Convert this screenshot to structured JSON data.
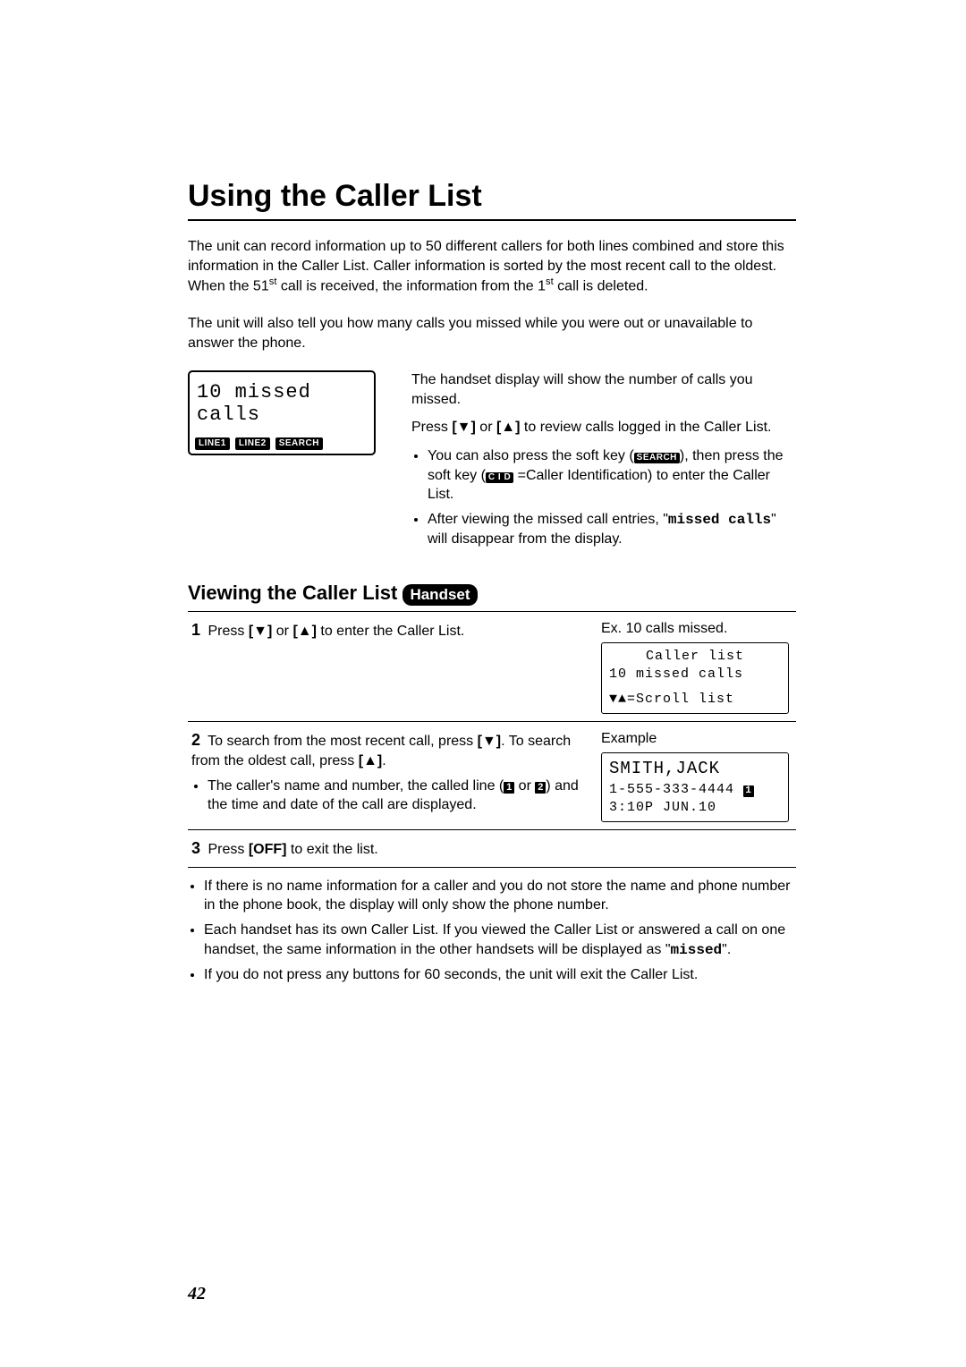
{
  "title": "Using the Caller List",
  "intro1_a": "The unit can record information up to 50 different callers for both lines combined and store this information in the Caller List. Caller information is sorted by the most recent call to the oldest. When the 51",
  "intro1_sup": "st",
  "intro1_b": " call is received, the information from the 1",
  "intro1_sup2": "st",
  "intro1_c": " call is deleted.",
  "intro2": "The unit will also tell you how many calls you missed while you were out or unavailable to answer the phone.",
  "handset_lcd": {
    "line1": "10 missed calls",
    "softkeys": [
      "LINE1",
      "LINE2",
      "SEARCH"
    ]
  },
  "right": {
    "p1": "The handset display will show the number of calls you missed.",
    "p2a": "Press ",
    "down": "[▼]",
    "or": " or ",
    "up": "[▲]",
    "p2b": " to review calls logged in the Caller List.",
    "b1a": "You can also press the soft key (",
    "b1_key1": "SEARCH",
    "b1b": "), then press the soft key (",
    "b1_key2": " C I D ",
    "b1c": " =Caller Identification) to enter the Caller List.",
    "b2a": "After viewing the missed call entries, \"",
    "b2_mono": "missed calls",
    "b2b": "\" will disappear from the display."
  },
  "subheading": "Viewing the Caller List",
  "badge": "Handset",
  "steps": {
    "s1": {
      "num": "1",
      "text_a": "Press ",
      "text_b": " to enter the Caller List.",
      "caption": "Ex. 10 calls missed.",
      "lcd": {
        "l1": "Caller list",
        "l2": "10 missed calls",
        "l3": "▼▲=Scroll list"
      }
    },
    "s2": {
      "num": "2",
      "text_a": "To search from the most recent call, press ",
      "text_bracket_down": "[▼]",
      "text_b": ". To search from the oldest call, press ",
      "text_bracket_up": "[▲]",
      "text_c": ".",
      "sub_a": "The caller's name and number, the called line (",
      "n1": "1",
      "sub_b": " or ",
      "n2": "2",
      "sub_c": ") and the time and date of the call are displayed.",
      "caption": "Example",
      "lcd": {
        "l1": "SMITH,JACK",
        "l2a": "1-555-333-4444 ",
        "l2n": "1",
        "l3": "3:10P JUN.10"
      }
    },
    "s3": {
      "num": "3",
      "text_a": "Press ",
      "off": "[OFF]",
      "text_b": " to exit the list."
    }
  },
  "footnotes": {
    "f1": "If there is no name information for a caller and you do not store the name and phone number in the phone book, the display will only show the phone number.",
    "f2a": "Each handset has its own Caller List. If you viewed the Caller List or answered a call on one handset, the same information in the other handsets will be displayed as \"",
    "f2_mono": "missed",
    "f2b": "\".",
    "f3": "If you do not press any buttons for 60 seconds, the unit will exit the Caller List."
  },
  "page_number": "42"
}
